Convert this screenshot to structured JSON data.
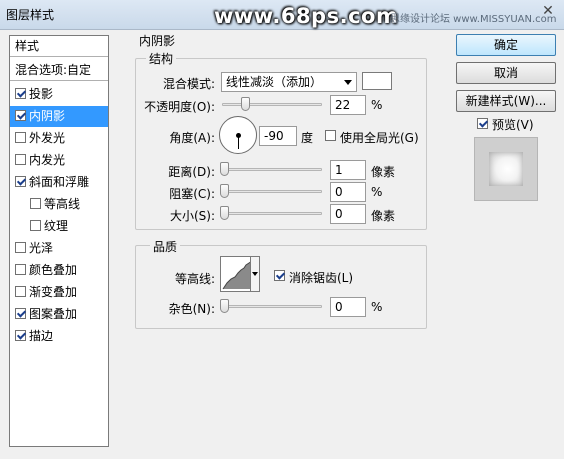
{
  "window": {
    "title": "图层样式",
    "watermark": "www.68ps.com",
    "watermark_right": "思缘设计论坛 www.MISSYUAN.com",
    "close_glyph": "✕"
  },
  "style_list": {
    "header": "样式",
    "blend_options": "混合选项:自定",
    "items": [
      {
        "label": "投影",
        "checked": true,
        "selected": false,
        "indent": false
      },
      {
        "label": "内阴影",
        "checked": true,
        "selected": true,
        "indent": false
      },
      {
        "label": "外发光",
        "checked": false,
        "selected": false,
        "indent": false
      },
      {
        "label": "内发光",
        "checked": false,
        "selected": false,
        "indent": false
      },
      {
        "label": "斜面和浮雕",
        "checked": true,
        "selected": false,
        "indent": false
      },
      {
        "label": "等高线",
        "checked": false,
        "selected": false,
        "indent": true
      },
      {
        "label": "纹理",
        "checked": false,
        "selected": false,
        "indent": true
      },
      {
        "label": "光泽",
        "checked": false,
        "selected": false,
        "indent": false
      },
      {
        "label": "颜色叠加",
        "checked": false,
        "selected": false,
        "indent": false
      },
      {
        "label": "渐变叠加",
        "checked": false,
        "selected": false,
        "indent": false
      },
      {
        "label": "图案叠加",
        "checked": true,
        "selected": false,
        "indent": false
      },
      {
        "label": "描边",
        "checked": true,
        "selected": false,
        "indent": false
      }
    ]
  },
  "panel": {
    "title": "内阴影",
    "structure": {
      "label": "结构",
      "blend_mode_label": "混合模式:",
      "blend_mode_value": "线性减淡（添加）",
      "swatch_color": "#ffffff",
      "opacity_label": "不透明度(O):",
      "opacity_value": "22",
      "opacity_fraction": 0.22,
      "percent": "%",
      "angle_label": "角度(A):",
      "angle_value": "-90",
      "angle_unit": "度",
      "global_light_label": "使用全局光(G)",
      "global_light_checked": false,
      "distance_label": "距离(D):",
      "distance_value": "1",
      "choke_label": "阻塞(C):",
      "choke_value": "0",
      "size_label": "大小(S):",
      "size_value": "0",
      "pixels": "像素"
    },
    "quality": {
      "label": "品质",
      "contour_label": "等高线:",
      "anti_alias_label": "消除锯齿(L)",
      "anti_alias_checked": true,
      "noise_label": "杂色(N):",
      "noise_value": "0"
    }
  },
  "buttons": {
    "ok": "确定",
    "cancel": "取消",
    "new_style": "新建样式(W)...",
    "preview_label": "预览(V)",
    "preview_checked": true
  },
  "colors": {
    "selection": "#3399ff",
    "panel_bg": "#f0f0f0"
  }
}
